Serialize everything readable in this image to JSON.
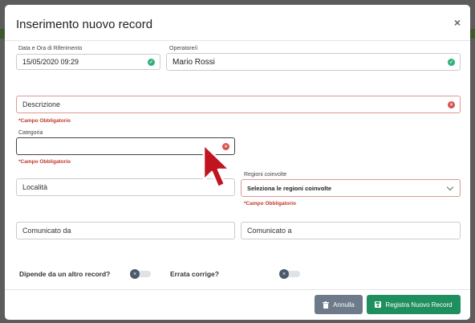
{
  "modal": {
    "title": "Inserimento nuovo record",
    "close_label": "×"
  },
  "fields": {
    "date_label": "Data e Ora di Riferimento",
    "date_value": "15/05/2020 09:29",
    "operator_label": "Operatore/i",
    "operator_value": "Mario Rossi",
    "description_placeholder": "Descrizione",
    "description_error": "*Campo Obbligatorio",
    "category_label": "Categoria",
    "category_value": "",
    "category_error": "*Campo Obbligatorio",
    "location_placeholder": "Località",
    "regions_label": "Regioni coinvolte",
    "regions_value": "Seleziona le regioni coinvolte",
    "regions_error": "*Campo Obbligatorio",
    "reported_by_placeholder": "Comunicato da",
    "reported_to_placeholder": "Comunicato a"
  },
  "toggles": {
    "depends_label": "Dipende da un altro record?",
    "depends_on": false,
    "errata_label": "Errata corrige?",
    "errata_on": false
  },
  "buttons": {
    "cancel_label": "Annulla",
    "save_label": "Registra Nuovo Record"
  },
  "icons": {
    "valid": "check-circle-icon",
    "invalid": "x-circle-icon",
    "cancel": "trash-icon",
    "save": "save-icon",
    "toggle_off": "x-icon",
    "cursor": "arrow-cursor-icon"
  },
  "colors": {
    "valid": "#2eb07a",
    "error": "#d9534f",
    "save_button": "#1f8f5f",
    "cancel_button": "#6c7a89",
    "cursor": "#c0141e"
  }
}
